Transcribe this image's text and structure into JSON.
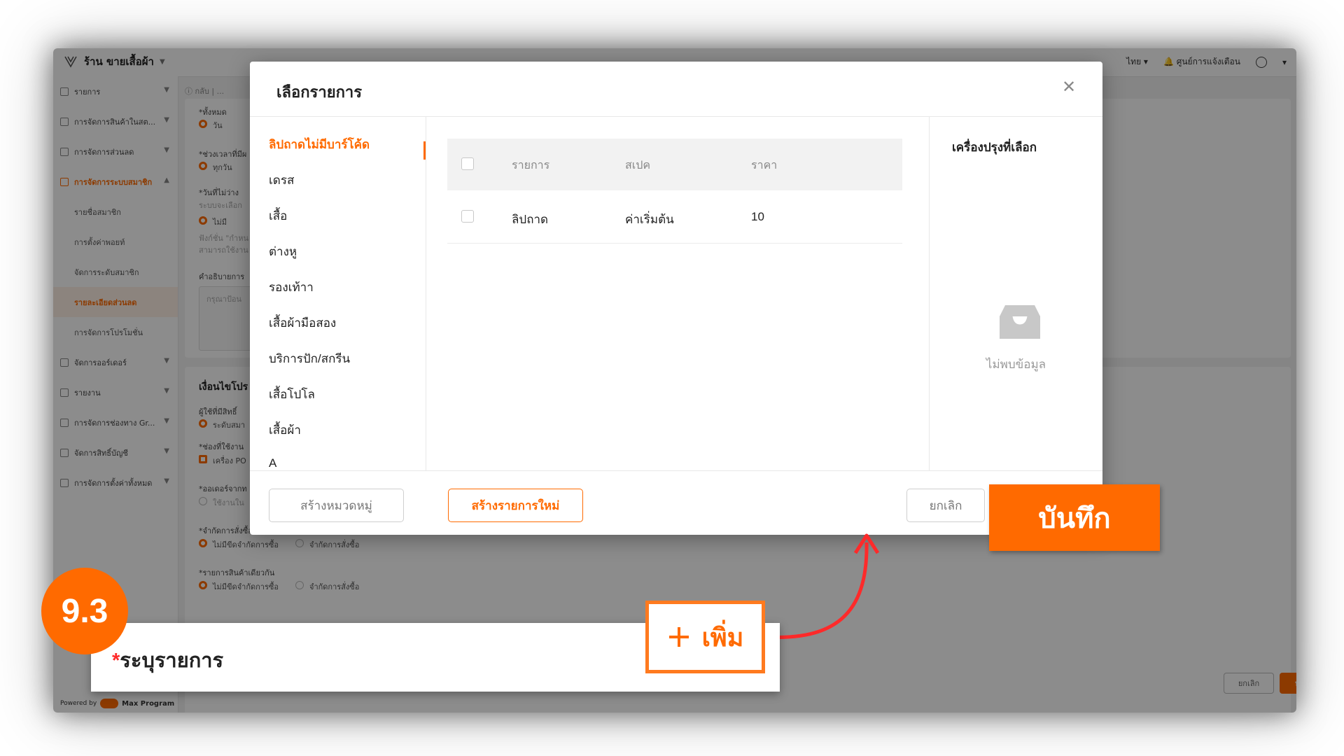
{
  "app": {
    "brand": "ร้าน ขายเสื้อผ้า",
    "topbar": {
      "language": "ไทย",
      "notifications": "ศูนย์การแจ้งเตือน"
    },
    "breadcrumb": "กลับ",
    "sidebar": [
      {
        "label": "รายการ"
      },
      {
        "label": "การจัดการสินค้าในสต..."
      },
      {
        "label": "การจัดการส่วนลด"
      },
      {
        "label": "การจัดการระบบสมาชิก",
        "open": true
      },
      {
        "label": "รายชื่อสมาชิก",
        "sub": true
      },
      {
        "label": "การตั้งค่าพอยท์",
        "sub": true
      },
      {
        "label": "จัดการระดับสมาชิก",
        "sub": true
      },
      {
        "label": "รายละเอียดส่วนลด",
        "sub": true,
        "active": true
      },
      {
        "label": "การจัดการโปรโมชั่น",
        "sub": true
      },
      {
        "label": "จัดการออร์เดอร์"
      },
      {
        "label": "รายงาน"
      },
      {
        "label": "การจัดการช่องทาง Gr..."
      },
      {
        "label": "จัดการสิทธิ์บัญชี"
      },
      {
        "label": "การจัดการตั้งค่าทั้งหมด"
      }
    ],
    "powered_by": "Powered by",
    "powered_brand": "Max Program",
    "form": {
      "all_label": "*ทั้งหมด",
      "day": "วัน",
      "period_label": "*ช่วงเวลาที่มีผ",
      "every_day": "ทุกวัน",
      "unavailable_label": "*วันที่ไม่ว่าง",
      "unavailable_hint": "ระบบจะเลือก",
      "none": "ไม่มี",
      "note1": "ฟังก์ชั่น \"กำหน",
      "note2": "สามารถใช้งาน",
      "desc_label": "คำอธิบายการ",
      "desc_placeholder": "กรุณาป้อน",
      "condition_title": "เงื่อนไขโปร",
      "eligible_label": "ผู้ใช้ที่มีสิทธิ์",
      "member_level": "ระดับสมา",
      "channel_label": "*ช่องที่ใช้งาน",
      "pos": "เครื่อง PO",
      "order_from_label": "*ออเดอร์จากท",
      "use_in": "ใช้งานใน",
      "limit_order_label": "*จำกัดการสั่งซื้อ",
      "no_limit": "ไม่มีขีดจำกัดการซื้อ",
      "limit": "จำกัดการสั่งซื้อ",
      "same_item_label": "*รายการสินค้าเดียวกัน",
      "cancel": "ยกเลิก",
      "save": "บันทึก"
    }
  },
  "modal": {
    "title": "เลือกรายการ",
    "categories": [
      "ลิปถาดไม่มีบาร์โค้ด",
      "เดรส",
      "เสื้อ",
      "ต่างหู",
      "รองเท้าา",
      "เสื้อผ้ามือสอง",
      "บริการปัก/สกรีน",
      "เสื้อโปโล",
      "เสื้อผ้า",
      "A"
    ],
    "table": {
      "headers": {
        "item": "รายการ",
        "spec": "สเปค",
        "price": "ราคา"
      },
      "rows": [
        {
          "item": "ลิปถาด",
          "spec": "ค่าเริ่มต้น",
          "price": "10"
        }
      ]
    },
    "selected_title": "เครื่องปรุงที่เลือก",
    "empty_text": "ไม่พบข้อมูล",
    "buttons": {
      "new_category": "สร้างหมวดหมู่",
      "new_item": "สร้างรายการใหม่",
      "cancel": "ยกเลิก"
    }
  },
  "overlay": {
    "save_label": "บันทึก",
    "field_required_mark": "*",
    "field_label": "ระบุรายการ",
    "add_label": "เพิ่ม",
    "step": "9.3"
  },
  "colors": {
    "accent": "#ff6a00",
    "arrow": "#ff2a2a"
  },
  "icons": {
    "close": "close-icon",
    "empty": "empty-inbox-icon",
    "plus": "plus-icon",
    "logo": "shop-logo-icon"
  }
}
